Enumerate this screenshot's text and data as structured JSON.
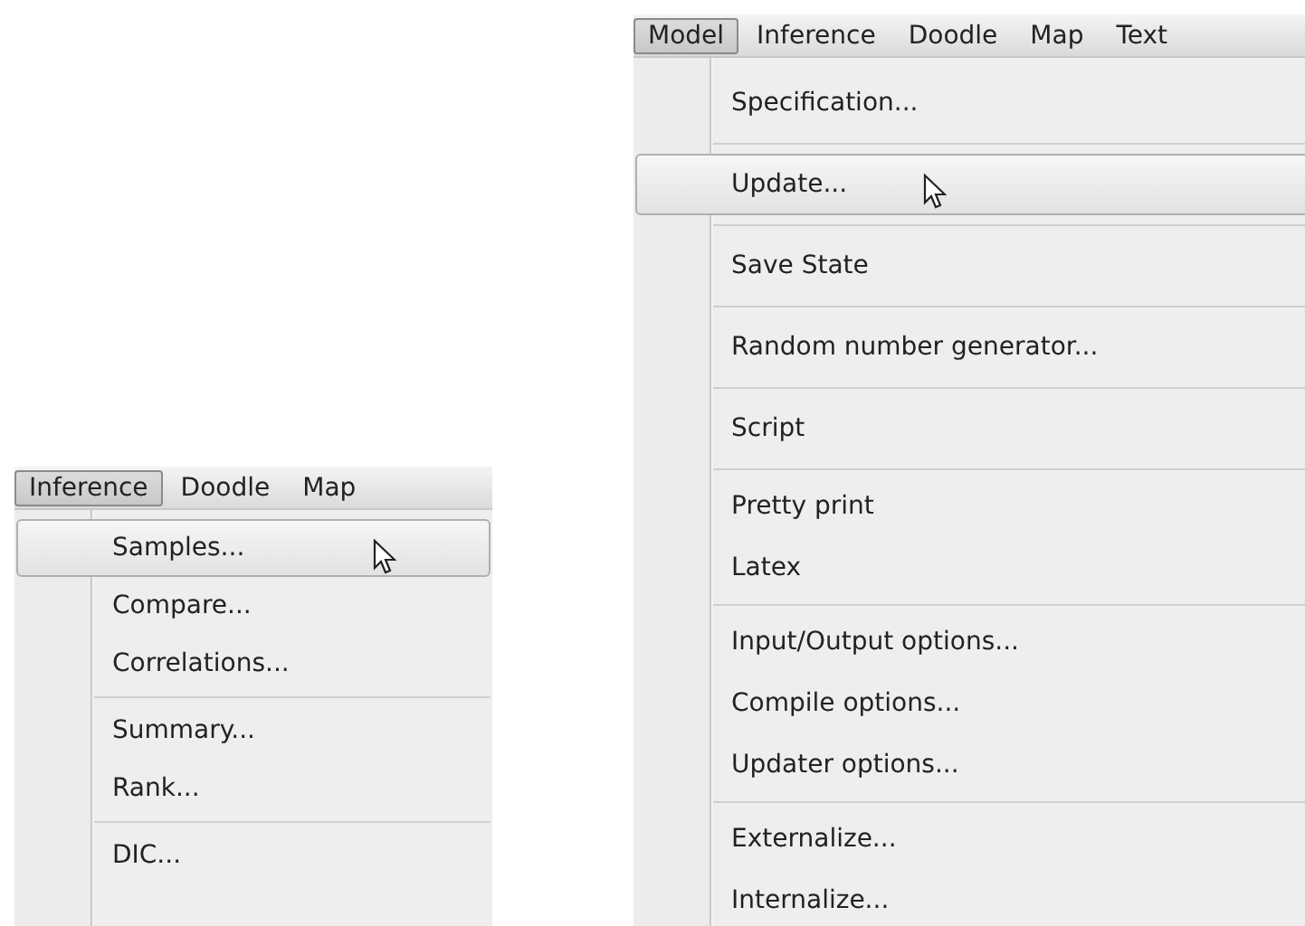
{
  "panels": [
    {
      "menubar": [
        {
          "label": "Inference",
          "selected": true
        },
        {
          "label": "Doodle",
          "selected": false
        },
        {
          "label": "Map",
          "selected": false
        }
      ],
      "menu": {
        "groups": [
          [
            {
              "label": "Samples...",
              "selected": true
            },
            {
              "label": "Compare...",
              "selected": false
            },
            {
              "label": "Correlations...",
              "selected": false
            }
          ],
          [
            {
              "label": "Summary...",
              "selected": false
            },
            {
              "label": "Rank...",
              "selected": false
            }
          ],
          [
            {
              "label": "DIC...",
              "selected": false
            }
          ]
        ]
      }
    },
    {
      "menubar": [
        {
          "label": "Model",
          "selected": true
        },
        {
          "label": "Inference",
          "selected": false
        },
        {
          "label": "Doodle",
          "selected": false
        },
        {
          "label": "Map",
          "selected": false
        },
        {
          "label": "Text",
          "selected": false
        }
      ],
      "menu": {
        "groups": [
          [
            {
              "label": "Specification...",
              "selected": false
            }
          ],
          [
            {
              "label": "Update...",
              "selected": true
            }
          ],
          [
            {
              "label": "Save State",
              "selected": false
            }
          ],
          [
            {
              "label": "Random number generator...",
              "selected": false
            }
          ],
          [
            {
              "label": "Script",
              "selected": false
            }
          ],
          [
            {
              "label": "Pretty print",
              "selected": false
            },
            {
              "label": "Latex",
              "selected": false
            }
          ],
          [
            {
              "label": "Input/Output options...",
              "selected": false
            },
            {
              "label": "Compile options...",
              "selected": false
            },
            {
              "label": "Updater options...",
              "selected": false
            }
          ],
          [
            {
              "label": "Externalize...",
              "selected": false
            },
            {
              "label": "Internalize...",
              "selected": false
            }
          ]
        ]
      }
    }
  ]
}
